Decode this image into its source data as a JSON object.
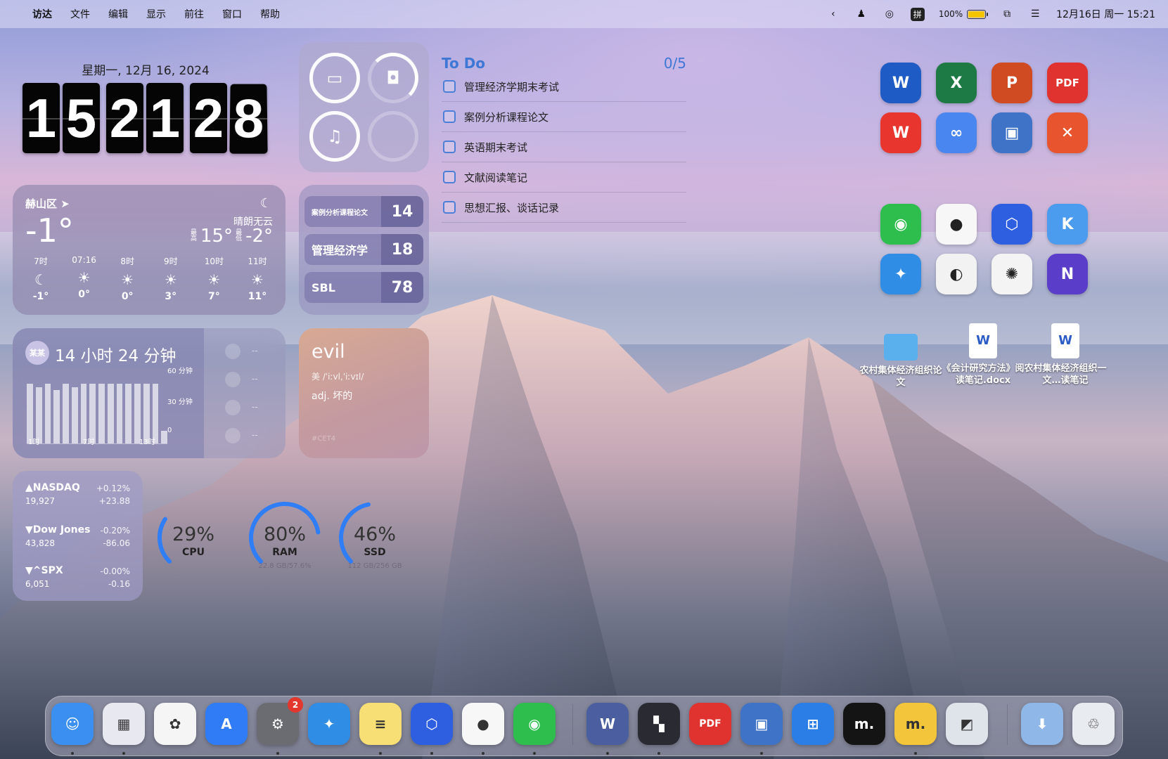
{
  "menubar": {
    "app_name": "访达",
    "menus": [
      "文件",
      "编辑",
      "显示",
      "前往",
      "窗口",
      "帮助"
    ],
    "ime": "拼",
    "battery_percent": "100%",
    "datetime": "12月16日 周一  15:21"
  },
  "clock": {
    "date_line": "星期一, 12月 16, 2024",
    "digits": [
      "1",
      "5",
      "2",
      "1",
      "2",
      "8"
    ]
  },
  "weather": {
    "location": "赫山区",
    "temperature": "-1°",
    "condition": "晴朗无云",
    "high_label": "最高",
    "high": "15°",
    "low_label": "最低",
    "low": "-2°",
    "hours": [
      {
        "time": "7时",
        "icon": "moon-icon",
        "glyph": "☾",
        "temp": "-1°"
      },
      {
        "time": "07:16",
        "icon": "sunrise-icon",
        "glyph": "☀",
        "temp": "0°"
      },
      {
        "time": "8时",
        "icon": "sun-icon",
        "glyph": "☀",
        "temp": "0°"
      },
      {
        "time": "9时",
        "icon": "sun-icon",
        "glyph": "☀",
        "temp": "3°"
      },
      {
        "time": "10时",
        "icon": "sun-icon",
        "glyph": "☀",
        "temp": "7°"
      },
      {
        "time": "11时",
        "icon": "sun-icon",
        "glyph": "☀",
        "temp": "11°"
      }
    ]
  },
  "battery_widget": {
    "devices": [
      "laptop-icon",
      "airpods-case-icon",
      "airpods-icon",
      "empty-slot"
    ]
  },
  "countdowns": [
    {
      "label": "案例分析课程论文",
      "value": "14"
    },
    {
      "label": "管理经济学",
      "value": "18"
    },
    {
      "label": "SBL",
      "value": "78"
    }
  ],
  "screen_time": {
    "avatar": "某某",
    "total": "14 小时 24 分钟",
    "y_labels": [
      "60 分钟",
      "30 分钟",
      "0"
    ],
    "x_labels": [
      "1时",
      "7时",
      "13时"
    ],
    "bars": [
      0.95,
      0.9,
      0.95,
      0.85,
      0.95,
      0.9,
      0.95,
      0.95,
      0.95,
      0.95,
      0.95,
      0.95,
      0.95,
      0.95,
      0.95,
      0.2
    ],
    "app_placeholders": [
      "--",
      "--",
      "--",
      "--"
    ]
  },
  "dictionary": {
    "word": "evil",
    "phonetic": "美  /ˈiːvl,ˈiːvɪl/",
    "meaning": "adj. 坏的",
    "tag": "#CET4"
  },
  "stocks": [
    {
      "name": "▲NASDAQ",
      "price": "19,927",
      "pct": "+0.12%",
      "change": "+23.88"
    },
    {
      "name": "▼Dow Jones",
      "price": "43,828",
      "pct": "-0.20%",
      "change": "-86.06"
    },
    {
      "name": "▼^SPX",
      "price": "6,051",
      "pct": "-0.00%",
      "change": "-0.16"
    }
  ],
  "system_stats": [
    {
      "value": "29%",
      "label": "CPU",
      "sub": "",
      "fraction": 0.29
    },
    {
      "value": "80%",
      "label": "RAM",
      "sub": "22.8 GB/57.6%",
      "fraction": 0.8
    },
    {
      "value": "46%",
      "label": "SSD",
      "sub": "112 GB/256 GB",
      "fraction": 0.46
    }
  ],
  "todo": {
    "title": "To Do",
    "count": "0/5",
    "items": [
      "管理经济学期末考试",
      "案例分析课程论文",
      "英语期末考试",
      "文献阅读笔记",
      "思想汇报、谈话记录"
    ]
  },
  "desktop_apps": [
    {
      "name": "word-icon",
      "glyph": "W",
      "color": "#1f5bc4"
    },
    {
      "name": "excel-icon",
      "glyph": "X",
      "color": "#1e7a44"
    },
    {
      "name": "powerpoint-icon",
      "glyph": "P",
      "color": "#d04a22"
    },
    {
      "name": "pdf-expert-icon",
      "glyph": "PDF",
      "color": "#e0322e"
    },
    {
      "name": "wps-icon",
      "glyph": "W",
      "color": "#e8352e"
    },
    {
      "name": "baidu-netdisk-icon",
      "glyph": "∞",
      "color": "#4a86ef"
    },
    {
      "name": "parallels-icon",
      "glyph": "▣",
      "color": "#3f73c7"
    },
    {
      "name": "xmind-icon",
      "glyph": "✕",
      "color": "#e8542d"
    },
    {
      "name": "wechat-icon",
      "glyph": "◉",
      "color": "#2dbe4d"
    },
    {
      "name": "qq-icon",
      "glyph": "●",
      "color": "#f7f7f7"
    },
    {
      "name": "hexagon-app-icon",
      "glyph": "⬡",
      "color": "#2e5fe0"
    },
    {
      "name": "klack-icon",
      "glyph": "K",
      "color": "#4b9bef"
    },
    {
      "name": "safari-icon",
      "glyph": "✦",
      "color": "#2f8de6"
    },
    {
      "name": "circle-app-icon",
      "glyph": "◐",
      "color": "#f2f2f2"
    },
    {
      "name": "chatgpt-icon",
      "glyph": "✺",
      "color": "#f4f4f4"
    },
    {
      "name": "n-logo-icon",
      "glyph": "N",
      "color": "#5a3dc8"
    }
  ],
  "desktop_files": [
    {
      "name": "folder-icon",
      "label": "农村集体经济组织论文"
    },
    {
      "name": "docx-file-icon",
      "label": "《会计研究方法》阅读笔记.docx"
    },
    {
      "name": "docx-file-icon",
      "label": "农村集体经济组织一文…读笔记"
    }
  ],
  "dock": [
    {
      "name": "finder-icon",
      "glyph": "☺",
      "color": "#3a8ff0"
    },
    {
      "name": "launchpad-icon",
      "glyph": "▦",
      "color": "#e8e8f0"
    },
    {
      "name": "photos-icon",
      "glyph": "✿",
      "color": "#f5f5f5"
    },
    {
      "name": "app-store-icon",
      "glyph": "A",
      "color": "#2f7cf6"
    },
    {
      "name": "system-settings-icon",
      "glyph": "⚙",
      "color": "#6b6b72",
      "badge": "2"
    },
    {
      "name": "safari-icon",
      "glyph": "✦",
      "color": "#2f8de6"
    },
    {
      "name": "notes-icon",
      "glyph": "≡",
      "color": "#f7df75"
    },
    {
      "name": "hexagon-app-icon",
      "glyph": "⬡",
      "color": "#2e5fe0"
    },
    {
      "name": "qq-icon",
      "glyph": "●",
      "color": "#f7f7f7"
    },
    {
      "name": "wechat-icon",
      "glyph": "◉",
      "color": "#2dbe4d"
    },
    {
      "name": "word-icon",
      "glyph": "W",
      "color": "#4b5ea0"
    },
    {
      "name": "tiles-app-icon",
      "glyph": "▚",
      "color": "#2a2a32"
    },
    {
      "name": "pdf-expert-icon",
      "glyph": "PDF",
      "color": "#e0322e"
    },
    {
      "name": "parallels-icon",
      "glyph": "▣",
      "color": "#3f73c7"
    },
    {
      "name": "windows-app-icon",
      "glyph": "⊞",
      "color": "#2a7ee6"
    },
    {
      "name": "mweb-icon",
      "glyph": "m.",
      "color": "#141414"
    },
    {
      "name": "mweb-lite-icon",
      "glyph": "m.",
      "color": "#f2c53a"
    },
    {
      "name": "preview-icon",
      "glyph": "◩",
      "color": "#dfe3ea"
    },
    {
      "name": "downloads-folder-icon",
      "glyph": "⬇",
      "color": "#8fb8e8"
    },
    {
      "name": "trash-icon",
      "glyph": "♲",
      "color": "#e8ecf0"
    }
  ]
}
